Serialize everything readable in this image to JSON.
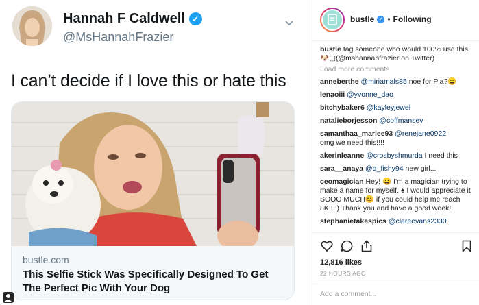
{
  "tweet": {
    "name": "Hannah F Caldwell",
    "handle": "@MsHannahFrazier",
    "text": "I can’t decide if I love this or hate this",
    "card": {
      "domain": "bustle.com",
      "title": "This Selfie Stick Was Specifically Designed To Get The Perfect Pic With Your Dog"
    }
  },
  "instagram": {
    "account": "bustle",
    "follow_status": "Following",
    "dot": "•",
    "caption": {
      "user": "bustle",
      "text": "tag someone who would 100% use this 🐶▢(@mshannahfrazier on Twitter)"
    },
    "load_more": "Load more comments",
    "comments": [
      {
        "user": "anneberthe",
        "mention": "@miriamals85",
        "text": "noe for Pia?😄"
      },
      {
        "user": "lenaoiii",
        "mention": "@yvonne_dao",
        "text": ""
      },
      {
        "user": "bitchybaker6",
        "mention": "@kayleyjewel",
        "text": ""
      },
      {
        "user": "natalieborjesson",
        "mention": "@coffmansev",
        "text": ""
      },
      {
        "user": "samanthaa_mariee93",
        "mention": "@renejane0922",
        "text": "omg we need this!!!!"
      },
      {
        "user": "akerinleanne",
        "mention": "@crosbyshmurda",
        "text": "I need this"
      },
      {
        "user": "sara__anaya",
        "mention": "@d_fishy94",
        "text": "new girl..."
      },
      {
        "user": "ceomagician",
        "mention": "",
        "text": "Hey! 😀 I'm a magician trying to make a name for myself. ♠ I would appreciate it SOOO MUCH😊 if you could help me reach 8K!! :) Thank you and have a good week!"
      },
      {
        "user": "stephanietakespics",
        "mention": "@clareevans2330",
        "text": ""
      }
    ],
    "likes": "12,816 likes",
    "time": "22 HOURS AGO",
    "add_comment_placeholder": "Add a comment..."
  },
  "colors": {
    "twitter_blue": "#1da1f2",
    "ig_verified": "#3897f0",
    "mention": "#003569",
    "muted": "#999999"
  },
  "icons": [
    "verified-badge-icon",
    "chevron-down-icon",
    "heart-icon",
    "comment-icon",
    "share-icon",
    "bookmark-icon",
    "account-tag-icon"
  ]
}
